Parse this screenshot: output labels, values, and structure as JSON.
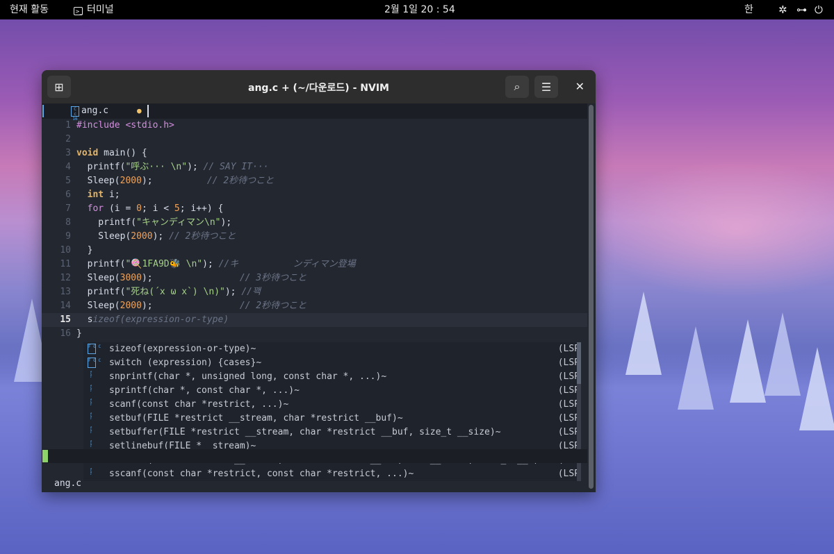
{
  "topbar": {
    "activities": "현재 활동",
    "app_name": "터미널",
    "clock": "2월 1일  20 : 54",
    "input_method": "한",
    "icons": [
      "accessibility-icon",
      "network-icon",
      "power-icon"
    ]
  },
  "window": {
    "title": "ang.c + (~/다운로드) - NVIM",
    "new_tab_icon": "⊞",
    "search_icon": "⌕",
    "menu_icon": "☰",
    "close_icon": "✕"
  },
  "editor": {
    "tab": {
      "filename": "ang.c",
      "modified_dot": "●",
      "icon_text": "C c 16"
    },
    "current_line": 15,
    "lines": [
      {
        "n": "1"
      },
      {
        "n": "2"
      },
      {
        "n": "3"
      },
      {
        "n": "4"
      },
      {
        "n": "5"
      },
      {
        "n": "6"
      },
      {
        "n": "7"
      },
      {
        "n": "8"
      },
      {
        "n": "9"
      },
      {
        "n": "10"
      },
      {
        "n": "11"
      },
      {
        "n": "12"
      },
      {
        "n": "13"
      },
      {
        "n": "14"
      },
      {
        "n": "15"
      },
      {
        "n": "16"
      }
    ],
    "code": {
      "l1": "#include <stdio.h>",
      "l3_kw": "void",
      "l3_rest": " main() {",
      "l4_fn": "  printf(",
      "l4_str": "\"呼ぶ··· \\n\"",
      "l4_end": ");",
      "l4_cmt": " // SAY IT···",
      "l5_fn": "  Sleep(",
      "l5_num": "2000",
      "l5_end": ");",
      "l5_cmt": "          // 2秒待つこと",
      "l6_kw": "  int",
      "l6_rest": " i;",
      "l7_kw": "  for",
      "l7_a": " (i = ",
      "l7_n1": "0",
      "l7_b": "; i < ",
      "l7_n2": "5",
      "l7_c": "; i++) {",
      "l8_fn": "    printf(",
      "l8_str": "\"キャンディマン\\n\"",
      "l8_end": ");",
      "l9_fn": "    Sleep(",
      "l9_num": "2000",
      "l9_end": ");",
      "l9_cmt": " // 2秒待つこと",
      "l10": "  }",
      "l11_fn": "  printf(",
      "l11_str": "\"🍭1FA9D🐝 \\n\"",
      "l11_end": ");",
      "l11_cmt": " //キ          ンディマン登場",
      "l12_fn": "  Sleep(",
      "l12_num": "3000",
      "l12_end": ");",
      "l12_cmt": "                // 3秒待つこと",
      "l13_fn": "  printf(",
      "l13_str": "\"死ね(´x ω x`) \\n)\"",
      "l13_end": ");",
      "l13_cmt": " //꽥",
      "l14_fn": "  Sleep(",
      "l14_num": "2000",
      "l14_end": ");",
      "l14_cmt": "                // 2秒待つこと",
      "l15_typed": "  s",
      "l15_ghost": "izeof(expression-or-type)",
      "l16": "}"
    }
  },
  "completion": {
    "source_label": "(LSP",
    "items": [
      {
        "text": "sizeof(expression-or-type)~"
      },
      {
        "text": "switch (expression) {cases}~"
      },
      {
        "text": "snprintf(char *, unsigned long, const char *, ...)~"
      },
      {
        "text": "sprintf(char *, const char *, ...)~"
      },
      {
        "text": "scanf(const char *restrict, ...)~"
      },
      {
        "text": "setbuf(FILE *restrict __stream, char *restrict __buf)~"
      },
      {
        "text": "setbuffer(FILE *restrict __stream, char *restrict __buf, size_t __size)~"
      },
      {
        "text": "setlinebuf(FILE *__stream)~"
      },
      {
        "text": "setvbuf(FILE *restrict __stream, char *restrict __buf, int __modes, size_t __n)~"
      },
      {
        "text": "sscanf(const char *restrict, const char *restrict, ...)~"
      }
    ]
  },
  "statusline": {
    "filename": "ang.c"
  }
}
